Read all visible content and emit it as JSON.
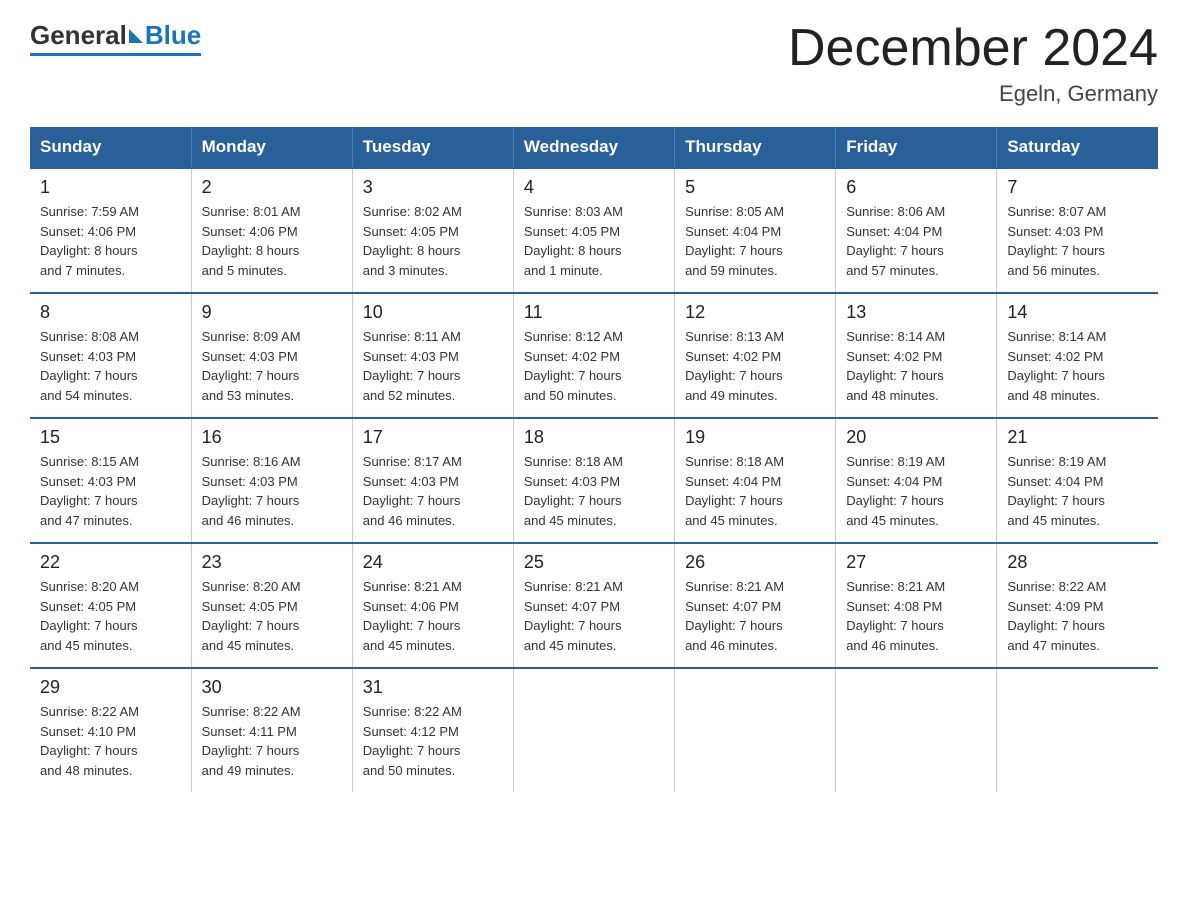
{
  "logo": {
    "general": "General",
    "blue": "Blue"
  },
  "title": "December 2024",
  "subtitle": "Egeln, Germany",
  "days_of_week": [
    "Sunday",
    "Monday",
    "Tuesday",
    "Wednesday",
    "Thursday",
    "Friday",
    "Saturday"
  ],
  "weeks": [
    [
      {
        "num": "1",
        "info": "Sunrise: 7:59 AM\nSunset: 4:06 PM\nDaylight: 8 hours\nand 7 minutes."
      },
      {
        "num": "2",
        "info": "Sunrise: 8:01 AM\nSunset: 4:06 PM\nDaylight: 8 hours\nand 5 minutes."
      },
      {
        "num": "3",
        "info": "Sunrise: 8:02 AM\nSunset: 4:05 PM\nDaylight: 8 hours\nand 3 minutes."
      },
      {
        "num": "4",
        "info": "Sunrise: 8:03 AM\nSunset: 4:05 PM\nDaylight: 8 hours\nand 1 minute."
      },
      {
        "num": "5",
        "info": "Sunrise: 8:05 AM\nSunset: 4:04 PM\nDaylight: 7 hours\nand 59 minutes."
      },
      {
        "num": "6",
        "info": "Sunrise: 8:06 AM\nSunset: 4:04 PM\nDaylight: 7 hours\nand 57 minutes."
      },
      {
        "num": "7",
        "info": "Sunrise: 8:07 AM\nSunset: 4:03 PM\nDaylight: 7 hours\nand 56 minutes."
      }
    ],
    [
      {
        "num": "8",
        "info": "Sunrise: 8:08 AM\nSunset: 4:03 PM\nDaylight: 7 hours\nand 54 minutes."
      },
      {
        "num": "9",
        "info": "Sunrise: 8:09 AM\nSunset: 4:03 PM\nDaylight: 7 hours\nand 53 minutes."
      },
      {
        "num": "10",
        "info": "Sunrise: 8:11 AM\nSunset: 4:03 PM\nDaylight: 7 hours\nand 52 minutes."
      },
      {
        "num": "11",
        "info": "Sunrise: 8:12 AM\nSunset: 4:02 PM\nDaylight: 7 hours\nand 50 minutes."
      },
      {
        "num": "12",
        "info": "Sunrise: 8:13 AM\nSunset: 4:02 PM\nDaylight: 7 hours\nand 49 minutes."
      },
      {
        "num": "13",
        "info": "Sunrise: 8:14 AM\nSunset: 4:02 PM\nDaylight: 7 hours\nand 48 minutes."
      },
      {
        "num": "14",
        "info": "Sunrise: 8:14 AM\nSunset: 4:02 PM\nDaylight: 7 hours\nand 48 minutes."
      }
    ],
    [
      {
        "num": "15",
        "info": "Sunrise: 8:15 AM\nSunset: 4:03 PM\nDaylight: 7 hours\nand 47 minutes."
      },
      {
        "num": "16",
        "info": "Sunrise: 8:16 AM\nSunset: 4:03 PM\nDaylight: 7 hours\nand 46 minutes."
      },
      {
        "num": "17",
        "info": "Sunrise: 8:17 AM\nSunset: 4:03 PM\nDaylight: 7 hours\nand 46 minutes."
      },
      {
        "num": "18",
        "info": "Sunrise: 8:18 AM\nSunset: 4:03 PM\nDaylight: 7 hours\nand 45 minutes."
      },
      {
        "num": "19",
        "info": "Sunrise: 8:18 AM\nSunset: 4:04 PM\nDaylight: 7 hours\nand 45 minutes."
      },
      {
        "num": "20",
        "info": "Sunrise: 8:19 AM\nSunset: 4:04 PM\nDaylight: 7 hours\nand 45 minutes."
      },
      {
        "num": "21",
        "info": "Sunrise: 8:19 AM\nSunset: 4:04 PM\nDaylight: 7 hours\nand 45 minutes."
      }
    ],
    [
      {
        "num": "22",
        "info": "Sunrise: 8:20 AM\nSunset: 4:05 PM\nDaylight: 7 hours\nand 45 minutes."
      },
      {
        "num": "23",
        "info": "Sunrise: 8:20 AM\nSunset: 4:05 PM\nDaylight: 7 hours\nand 45 minutes."
      },
      {
        "num": "24",
        "info": "Sunrise: 8:21 AM\nSunset: 4:06 PM\nDaylight: 7 hours\nand 45 minutes."
      },
      {
        "num": "25",
        "info": "Sunrise: 8:21 AM\nSunset: 4:07 PM\nDaylight: 7 hours\nand 45 minutes."
      },
      {
        "num": "26",
        "info": "Sunrise: 8:21 AM\nSunset: 4:07 PM\nDaylight: 7 hours\nand 46 minutes."
      },
      {
        "num": "27",
        "info": "Sunrise: 8:21 AM\nSunset: 4:08 PM\nDaylight: 7 hours\nand 46 minutes."
      },
      {
        "num": "28",
        "info": "Sunrise: 8:22 AM\nSunset: 4:09 PM\nDaylight: 7 hours\nand 47 minutes."
      }
    ],
    [
      {
        "num": "29",
        "info": "Sunrise: 8:22 AM\nSunset: 4:10 PM\nDaylight: 7 hours\nand 48 minutes."
      },
      {
        "num": "30",
        "info": "Sunrise: 8:22 AM\nSunset: 4:11 PM\nDaylight: 7 hours\nand 49 minutes."
      },
      {
        "num": "31",
        "info": "Sunrise: 8:22 AM\nSunset: 4:12 PM\nDaylight: 7 hours\nand 50 minutes."
      },
      {
        "num": "",
        "info": ""
      },
      {
        "num": "",
        "info": ""
      },
      {
        "num": "",
        "info": ""
      },
      {
        "num": "",
        "info": ""
      }
    ]
  ]
}
